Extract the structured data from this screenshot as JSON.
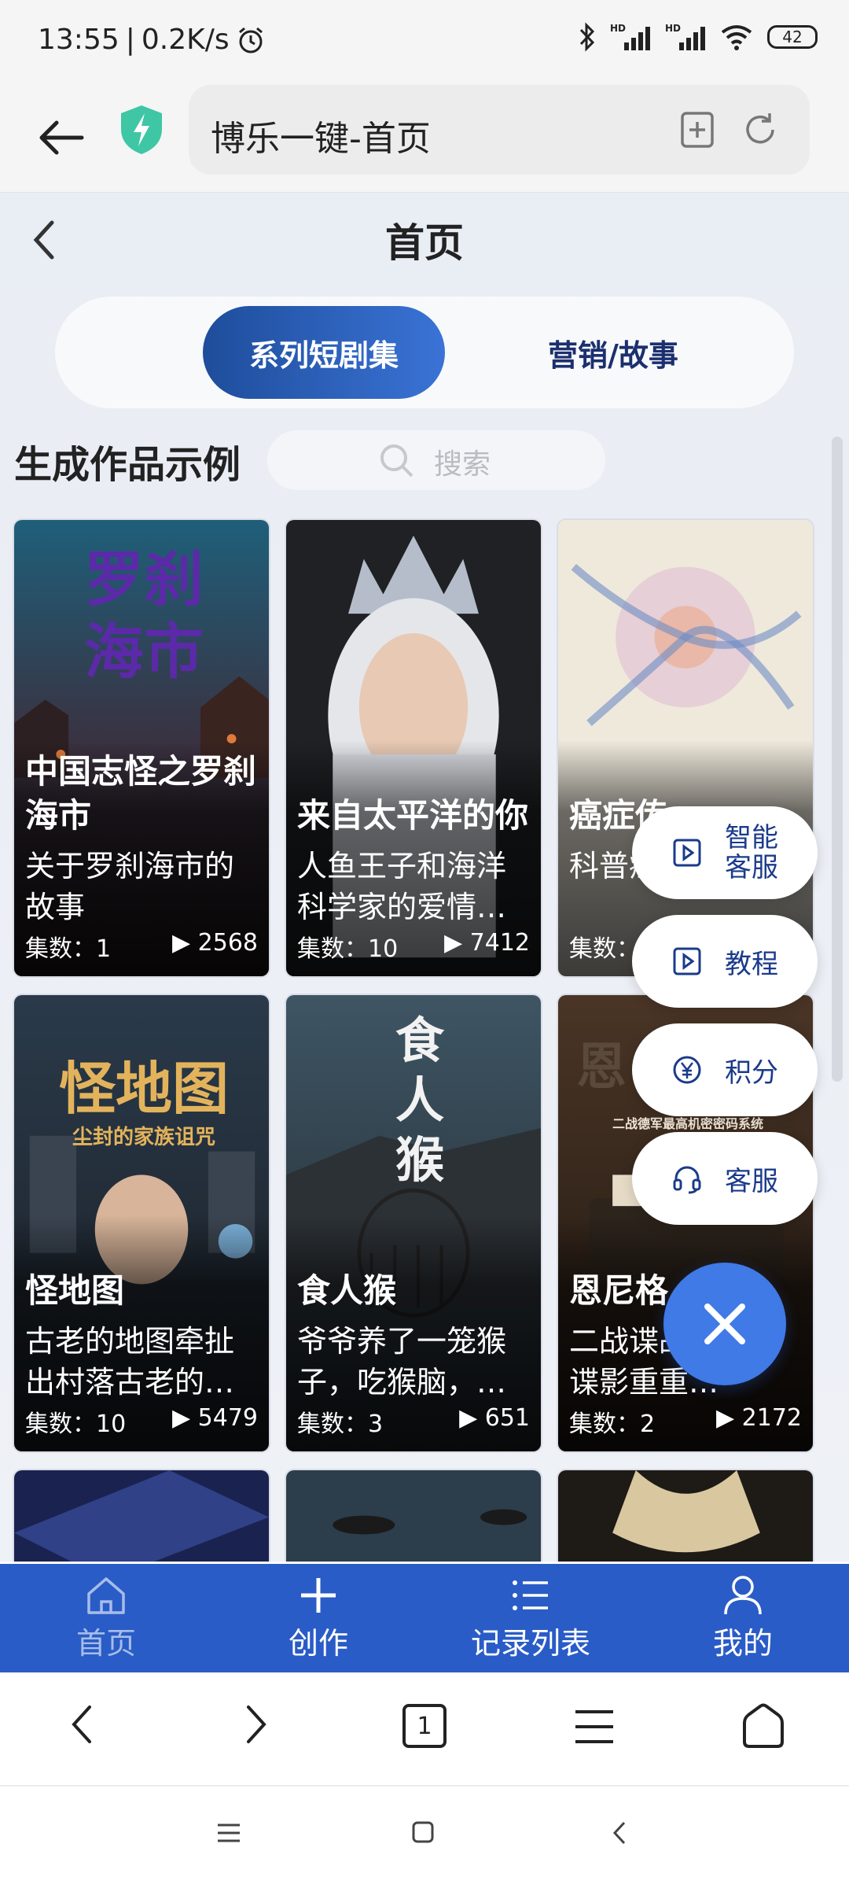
{
  "status": {
    "time": "13:55",
    "net_speed": "0.2K/s",
    "battery": "42"
  },
  "browser": {
    "url_title": "博乐一键-首页",
    "tab_count": "1"
  },
  "page": {
    "title": "首页",
    "tabs": [
      {
        "label": "系列短剧集",
        "active": true
      },
      {
        "label": "营销/故事",
        "active": false
      }
    ],
    "section_title": "生成作品示例",
    "search_placeholder": "搜索",
    "cards": [
      {
        "title": "中国志怪之罗刹海市",
        "desc": "关于罗刹海市的故事",
        "episodes": "集数：1",
        "views": "2568",
        "art_text": "罗刹\n海市"
      },
      {
        "title": "来自太平洋的你",
        "desc": "人鱼王子和海洋科学家的爱情…",
        "episodes": "集数：10",
        "views": "7412",
        "art_text": ""
      },
      {
        "title": "癌症传",
        "desc": "科普癌症的传记",
        "episodes": "集数：",
        "views": "",
        "art_text": ""
      },
      {
        "title": "怪地图",
        "desc": "古老的地图牵扯出村落古老的…",
        "episodes": "集数：10",
        "views": "5479",
        "art_text": "怪地图",
        "art_sub": "尘封的家族诅咒"
      },
      {
        "title": "食人猴",
        "desc": "爷爷养了一笼猴子，吃猴脑，…",
        "episodes": "集数：3",
        "views": "651",
        "art_text": "食\n人\n猴"
      },
      {
        "title": "恩尼格",
        "desc": "二战谍战，莱坞谍影重重…",
        "episodes": "集数：2",
        "views": "2172",
        "art_text": "恩",
        "art_sub": "二战德军最高机密密码系统"
      }
    ]
  },
  "float_menu": [
    {
      "label": "智能客服",
      "icon": "play-square-icon"
    },
    {
      "label": "教程",
      "icon": "play-square-icon"
    },
    {
      "label": "积分",
      "icon": "yen-circle-icon"
    },
    {
      "label": "客服",
      "icon": "headset-icon"
    }
  ],
  "app_tabs": [
    {
      "label": "首页",
      "icon": "home-icon",
      "active": true
    },
    {
      "label": "创作",
      "icon": "plus-icon",
      "active": false
    },
    {
      "label": "记录列表",
      "icon": "list-icon",
      "active": false
    },
    {
      "label": "我的",
      "icon": "user-icon",
      "active": false
    }
  ],
  "colors": {
    "primary": "#2a5cc7",
    "accent": "#3f7ae6",
    "active_tab_text": "#a7bde8"
  }
}
